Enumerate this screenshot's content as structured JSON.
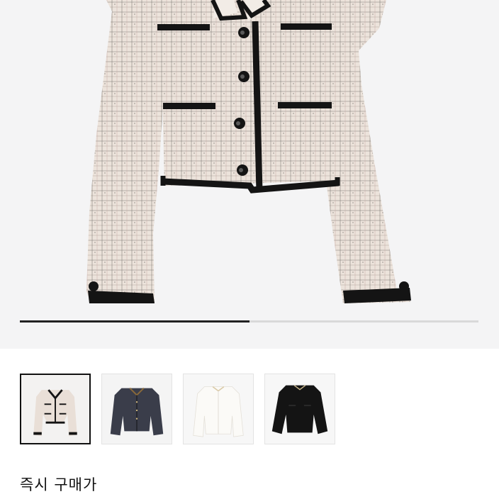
{
  "hero": {
    "image_name": "tweed-jacket-ivory",
    "carousel_progress": 0.5
  },
  "thumbnails": [
    {
      "name": "tweed-jacket-ivory",
      "selected": true
    },
    {
      "name": "tweed-jacket-navy",
      "selected": false
    },
    {
      "name": "jacket-white",
      "selected": false
    },
    {
      "name": "jacket-black",
      "selected": false
    }
  ],
  "colors": {
    "tweed": "#ebe2da",
    "trim": "#141414",
    "progress_fill": "#222222",
    "progress_track": "#d9d9d9"
  },
  "actions": {
    "buy_now_label": "즉시 구매가"
  }
}
